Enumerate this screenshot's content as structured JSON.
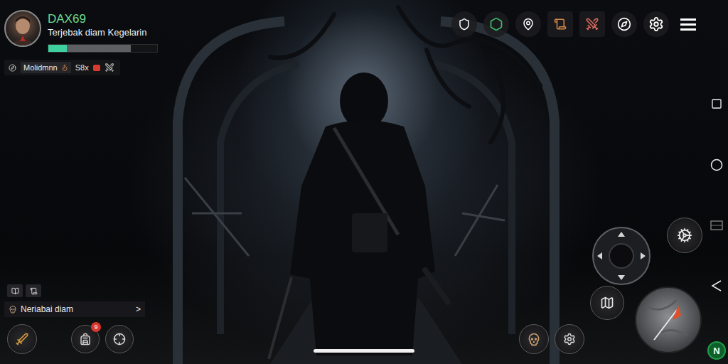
{
  "player": {
    "name": "DAX69",
    "status": "Terjebak diam Kegelarin",
    "health": {
      "level": 0.17
    }
  },
  "buff_bar": {
    "label": "Molidmnn",
    "value": "S8x"
  },
  "quest_tracker": {
    "label": "Neriabai diam",
    "arrow": ">"
  },
  "inventory_button": {
    "badge": "9"
  },
  "nav_logo": "N"
}
